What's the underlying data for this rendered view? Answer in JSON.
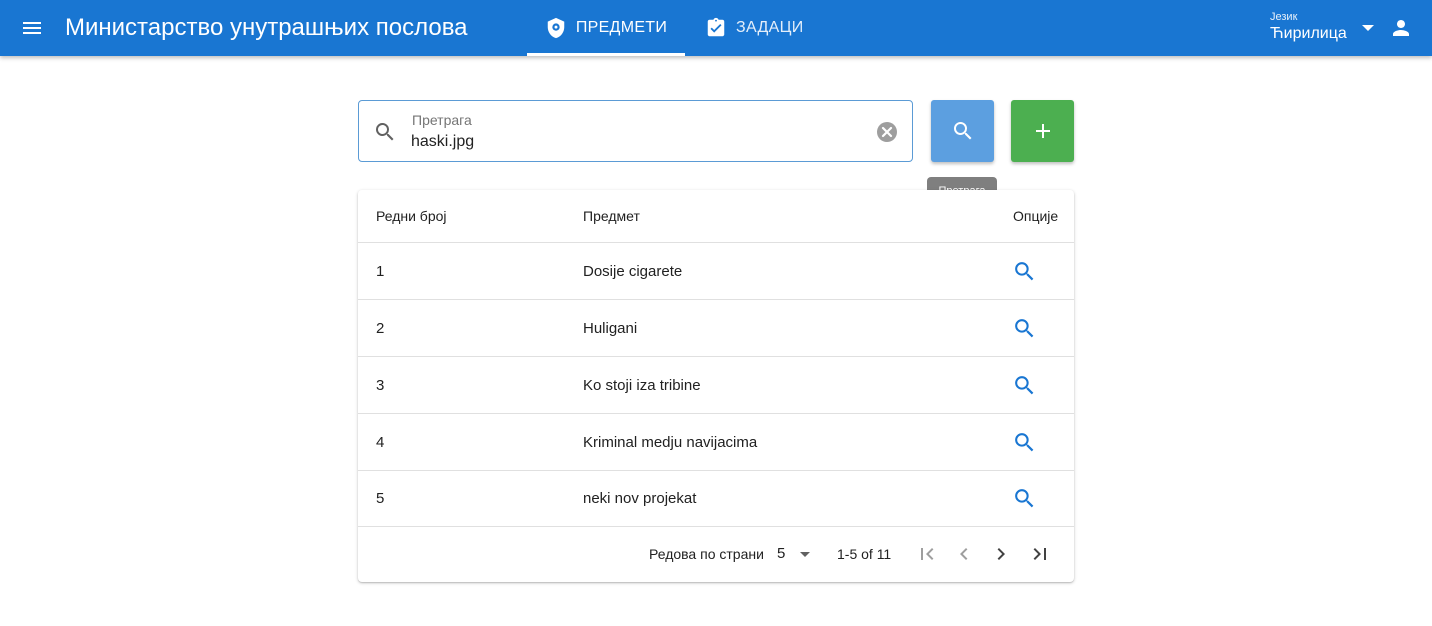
{
  "header": {
    "title": "Министарство унутрашњих послова",
    "tabs": [
      {
        "label": "ПРЕДМЕТИ",
        "icon": "shield-icon",
        "active": true
      },
      {
        "label": "ЗАДАЦИ",
        "icon": "clipboard-check-icon",
        "active": false
      }
    ],
    "language": {
      "label": "Језик",
      "value": "Ћирилица"
    }
  },
  "search": {
    "label": "Претрага",
    "value": "haski.jpg",
    "tooltip": "Претрага"
  },
  "table": {
    "columns": [
      "Редни број",
      "Предмет",
      "Опције"
    ],
    "rows": [
      {
        "number": "1",
        "subject": "Dosije cigarete"
      },
      {
        "number": "2",
        "subject": "Huligani"
      },
      {
        "number": "3",
        "subject": "Ko stoji iza tribine"
      },
      {
        "number": "4",
        "subject": "Kriminal medju navijacima"
      },
      {
        "number": "5",
        "subject": "neki nov projekat"
      }
    ],
    "pagination": {
      "rows_per_page_label": "Редова по страни",
      "rows_per_page": "5",
      "range": "1-5 of 11"
    }
  },
  "colors": {
    "primary": "#1976d2",
    "search_button": "#5c9fe0",
    "add_button": "#4caf50",
    "row_icon": "#1976d2"
  }
}
